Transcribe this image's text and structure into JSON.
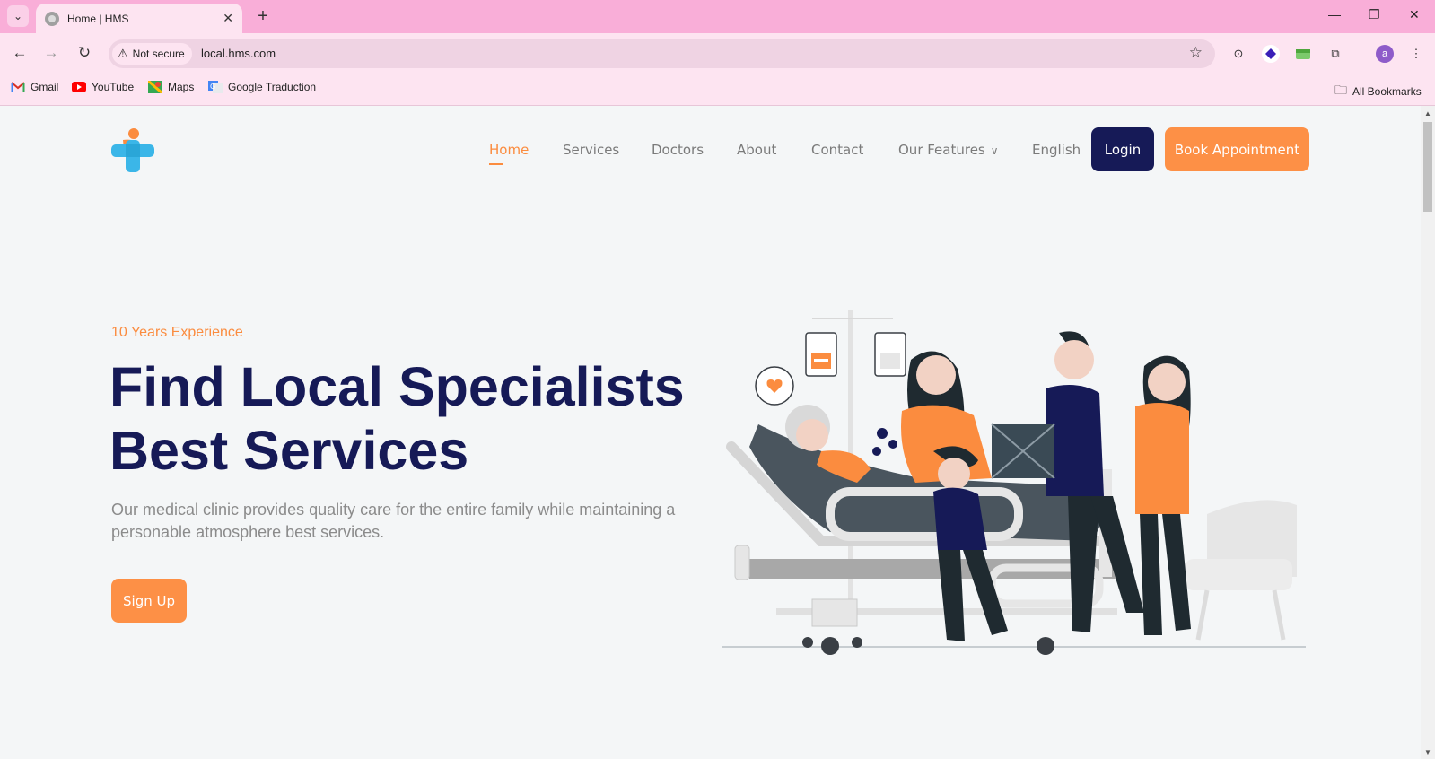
{
  "browser": {
    "tab_title": "Home | HMS",
    "security_label": "Not secure",
    "url": "local.hms.com",
    "profile_initial": "a",
    "bookmarks": [
      {
        "label": "Gmail"
      },
      {
        "label": "YouTube"
      },
      {
        "label": "Maps"
      },
      {
        "label": "Google Traduction"
      }
    ],
    "all_bookmarks_label": "All Bookmarks"
  },
  "nav": {
    "links": [
      "Home",
      "Services",
      "Doctors",
      "About",
      "Contact",
      "Our Features",
      "English"
    ],
    "active": "Home",
    "login_label": "Login",
    "book_label": "Book Appointment"
  },
  "hero": {
    "eyebrow": "10 Years Experience",
    "headline_line1": "Find Local Specialists",
    "headline_line2": "Best Services",
    "lead": "Our medical clinic provides quality care for the entire family while maintaining a personable atmosphere best services.",
    "signup_label": "Sign Up"
  },
  "colors": {
    "brand_navy": "#161a57",
    "brand_orange": "#fd9046",
    "page_bg": "#f4f6f7",
    "chrome_pink": "#f9aed8"
  }
}
